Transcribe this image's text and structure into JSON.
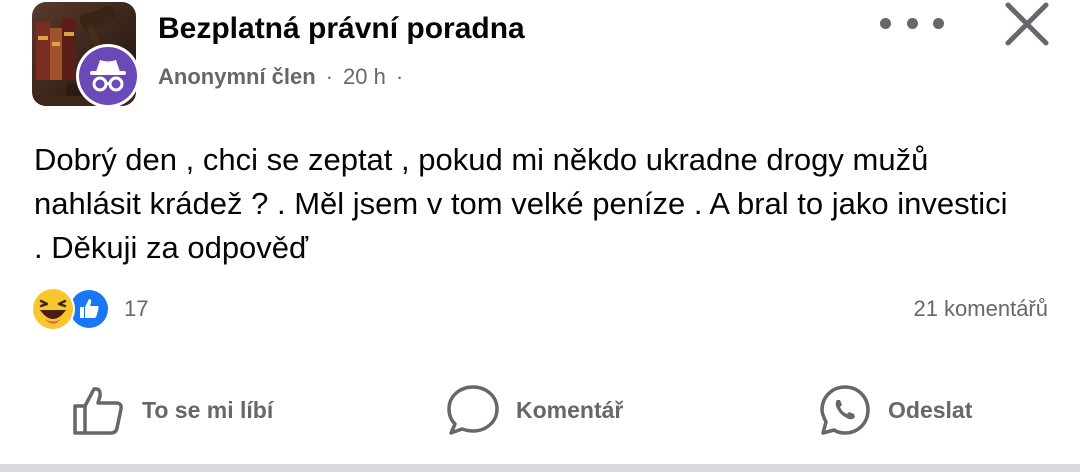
{
  "header": {
    "group_name": "Bezplatná právní poradna",
    "author": "Anonymní člen",
    "separator": "·",
    "time": "20 h",
    "icons": {
      "group_image": "gavel-books-image",
      "avatar": "anonymous-incognito-icon",
      "more": "more-dots-icon",
      "close": "close-icon"
    }
  },
  "post": {
    "text": "Dobrý den , chci se zeptat , pokud mi někdo ukradne drogy mužů nahlásit krádež ? . Měl jsem v tom velké peníze . A bral to jako investici . Děkuji za odpověď"
  },
  "stats": {
    "reactions": [
      "haha-emoji-icon",
      "like-icon"
    ],
    "reaction_count": "17",
    "comments": "21 komentářů"
  },
  "actions": {
    "like_label": "To se mi líbí",
    "comment_label": "Komentář",
    "send_label": "Odeslat"
  },
  "colors": {
    "text": "#050505",
    "secondary": "#65676b",
    "like_blue": "#1877f2",
    "avatar_purple": "#6b4ab8",
    "haha_yellow": "#f7c52d"
  }
}
